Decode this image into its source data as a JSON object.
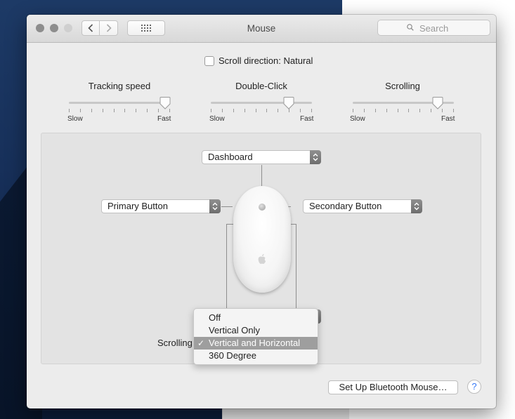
{
  "window": {
    "title": "Mouse"
  },
  "toolbar": {
    "search_placeholder": "Search"
  },
  "scroll_direction": {
    "label": "Scroll direction: Natural",
    "checked": false
  },
  "sliders": [
    {
      "label": "Tracking speed",
      "min_label": "Slow",
      "max_label": "Fast",
      "value": 0.95
    },
    {
      "label": "Double-Click",
      "min_label": "Slow",
      "max_label": "Fast",
      "value": 0.77
    },
    {
      "label": "Scrolling",
      "min_label": "Slow",
      "max_label": "Fast",
      "value": 0.84
    }
  ],
  "buttons": {
    "top": "Dashboard",
    "primary": "Primary Button",
    "secondary": "Secondary Button"
  },
  "scrolling": {
    "label": "Scrolling",
    "options": [
      "Off",
      "Vertical Only",
      "Vertical and Horizontal",
      "360 Degree"
    ],
    "selected": "Vertical and Horizontal"
  },
  "footer": {
    "bluetooth_button": "Set Up Bluetooth Mouse…",
    "help_label": "?"
  },
  "colors": {
    "menu_highlight": "#9e9e9e",
    "help_accent": "#3478f6"
  }
}
